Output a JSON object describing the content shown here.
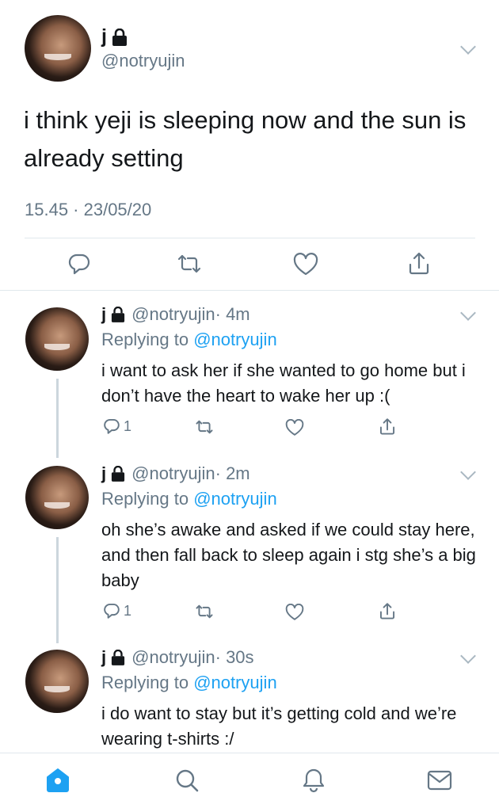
{
  "main_tweet": {
    "name": "j",
    "handle": "@notryujin",
    "text": "i think yeji is sleeping now and the sun is already setting",
    "timestamp": "15.45 · 23/05/20"
  },
  "replies": [
    {
      "name": "j",
      "handle": "@notryujin",
      "age": "· 4m",
      "replying_prefix": "Replying to ",
      "replying_to": "@notryujin",
      "text": "i want to ask her if she wanted to go home but i don’t have the heart to wake her up :(",
      "reply_count": "1"
    },
    {
      "name": "j",
      "handle": "@notryujin",
      "age": "· 2m",
      "replying_prefix": "Replying to ",
      "replying_to": "@notryujin",
      "text": "oh she’s awake and asked if we could stay here, and then fall back to sleep again i stg she’s a big baby",
      "reply_count": "1"
    },
    {
      "name": "j",
      "handle": "@notryujin",
      "age": "· 30s",
      "replying_prefix": "Replying to ",
      "replying_to": "@notryujin",
      "text": "i do want to stay but it’s getting cold and we’re wearing t-shirts :/"
    }
  ],
  "tabbar": {
    "items": [
      "home-icon",
      "search-icon",
      "notifications-icon",
      "messages-icon"
    ],
    "active_color": "#1da1f2",
    "inactive_color": "#657786"
  }
}
